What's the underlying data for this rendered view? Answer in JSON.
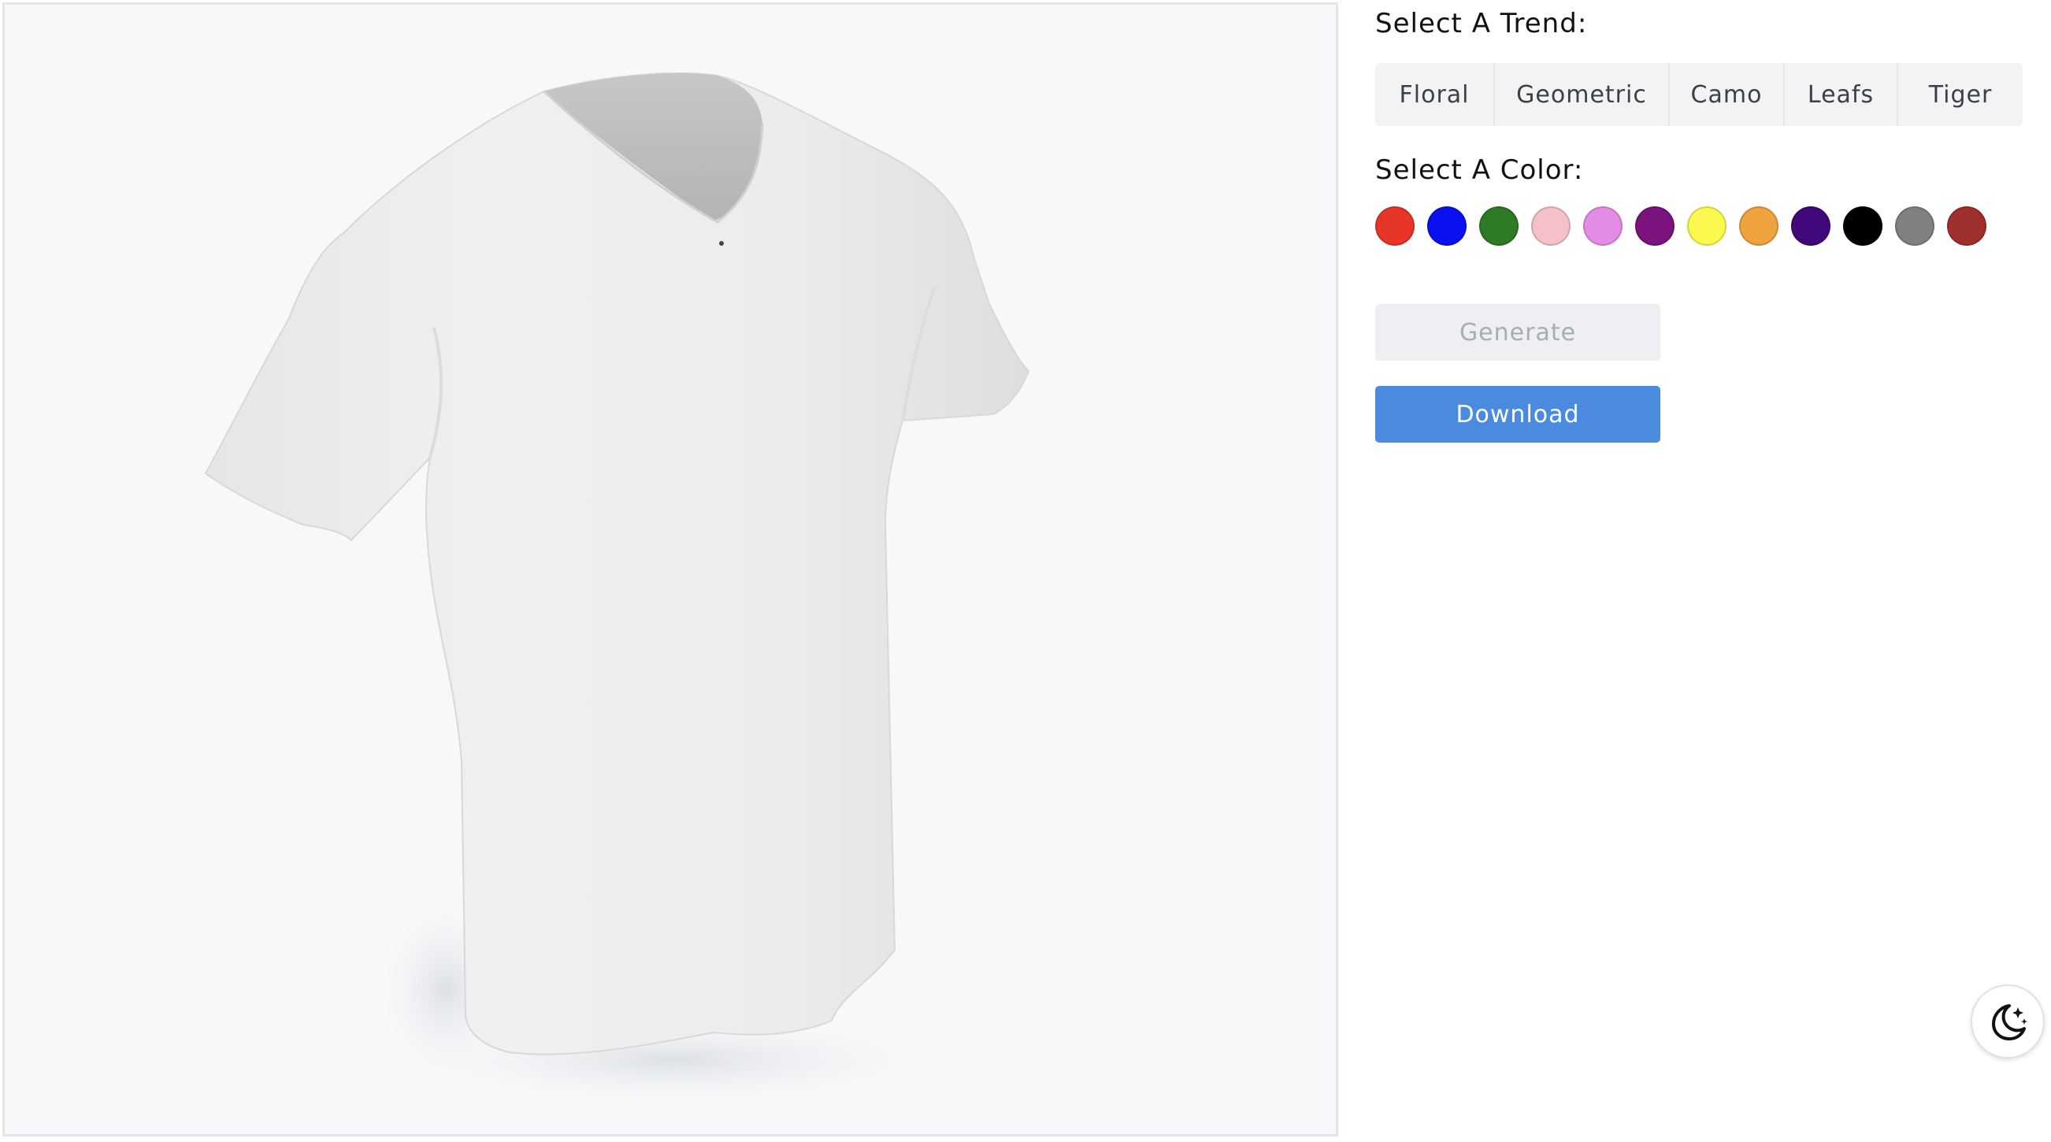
{
  "trend_section": {
    "label": "Select A Trend:",
    "options": [
      "Floral",
      "Geometric",
      "Camo",
      "Leafs",
      "Tiger"
    ]
  },
  "color_section": {
    "label": "Select A Color:",
    "swatches": [
      {
        "name": "red",
        "hex": "#e8352a"
      },
      {
        "name": "blue",
        "hex": "#0b10ee"
      },
      {
        "name": "green",
        "hex": "#2f7a24"
      },
      {
        "name": "pink",
        "hex": "#f5c1c8"
      },
      {
        "name": "violet",
        "hex": "#e48be6"
      },
      {
        "name": "purple",
        "hex": "#7a137d"
      },
      {
        "name": "yellow",
        "hex": "#fbf84e"
      },
      {
        "name": "orange",
        "hex": "#eea33f"
      },
      {
        "name": "indigo",
        "hex": "#40087a"
      },
      {
        "name": "black",
        "hex": "#000000"
      },
      {
        "name": "gray",
        "hex": "#808080"
      },
      {
        "name": "brown",
        "hex": "#a0302d"
      }
    ]
  },
  "actions": {
    "generate_label": "Generate",
    "download_label": "Download"
  },
  "colors": {
    "accent": "#4a8be0",
    "viewer_background": "#f6f8fa"
  },
  "icons": {
    "theme_toggle": "moon-stars-icon",
    "viewer_model": "tshirt-3d-model"
  }
}
